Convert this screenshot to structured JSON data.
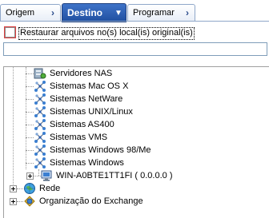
{
  "tabs": [
    {
      "label": "Origem",
      "active": false
    },
    {
      "label": "Destino",
      "active": true
    },
    {
      "label": "Programar",
      "active": false
    }
  ],
  "restore": {
    "checkbox_label": "Restaurar arquivos no(s) local(is) original(is)",
    "checked": false
  },
  "path_input": {
    "value": ""
  },
  "tree": {
    "items": [
      {
        "label": "Servidores NAS",
        "icon": "nas-server-icon"
      },
      {
        "label": "Sistemas Mac OS X",
        "icon": "network-node-icon"
      },
      {
        "label": "Sistemas NetWare",
        "icon": "network-node-icon"
      },
      {
        "label": "Sistemas UNIX/Linux",
        "icon": "network-node-icon"
      },
      {
        "label": "Sistemas AS400",
        "icon": "network-node-icon"
      },
      {
        "label": "Sistemas VMS",
        "icon": "network-node-icon"
      },
      {
        "label": "Sistemas Windows 98/Me",
        "icon": "network-node-icon"
      },
      {
        "label": "Sistemas Windows",
        "icon": "network-node-icon"
      },
      {
        "label": "WIN-A0BTE1TT1FI ( 0.0.0.0 )",
        "icon": "computer-icon"
      },
      {
        "label": "Rede",
        "icon": "network-globe-icon"
      },
      {
        "label": "Organização do Exchange",
        "icon": "exchange-icon"
      }
    ]
  },
  "colors": {
    "active_tab": "#2a5db0",
    "tab_border": "#8fa7c9",
    "checkbox_focus": "#e04040"
  }
}
